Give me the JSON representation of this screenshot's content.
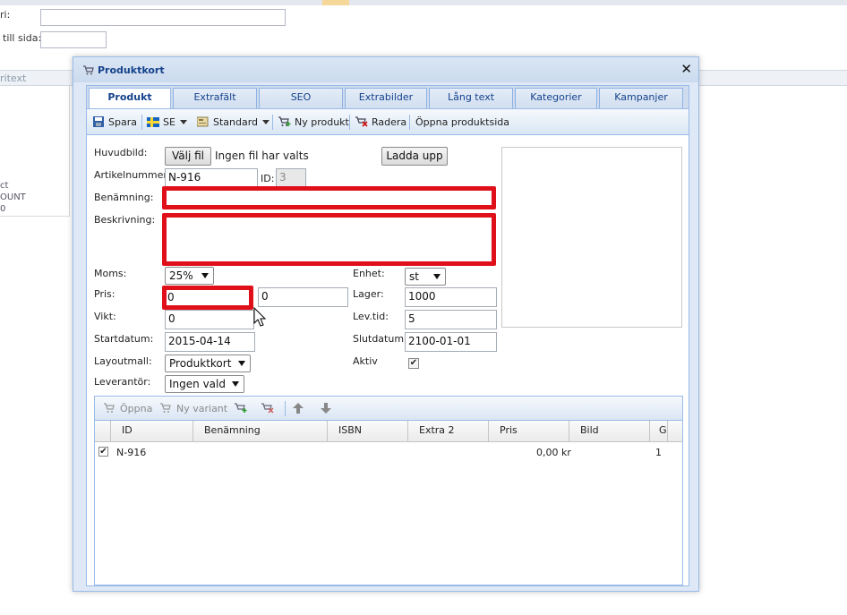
{
  "background": {
    "labels": {
      "field1": "ri:",
      "field2": "till sida:",
      "header": "ritext",
      "left_line1": "ct",
      "left_line2": "OUNT",
      "left_line3": "0"
    }
  },
  "window": {
    "title": "Produktkort",
    "close_symbol": "✕"
  },
  "tabs": [
    "Produkt",
    "Extrafält",
    "SEO",
    "Extrabilder",
    "Lång text",
    "Kategorier",
    "Kampanjer"
  ],
  "active_tab": "Produkt",
  "toolbar": {
    "save": "Spara",
    "language": "SE",
    "template": "Standard",
    "new_product": "Ny produkt",
    "delete": "Radera",
    "open_page": "Öppna produktsida"
  },
  "form": {
    "main_image_label": "Huvudbild:",
    "choose_file": "Välj fil",
    "no_file": "Ingen fil har valts",
    "upload": "Ladda upp",
    "article_label": "Artikelnummer:",
    "article_value": "N-916",
    "id_label": "ID:",
    "id_value": "3",
    "name_label": "Benämning:",
    "name_value": "",
    "description_label": "Beskrivning:",
    "description_value": "",
    "vat_label": "Moms:",
    "vat_value": "25%",
    "price_label": "Pris:",
    "price_value": "0",
    "price_value2": "0",
    "weight_label": "Vikt:",
    "weight_value": "0",
    "start_label": "Startdatum:",
    "start_value": "2015-04-14",
    "layout_label": "Layoutmall:",
    "layout_value": "Produktkort",
    "supplier_label": "Leverantör:",
    "supplier_value": "Ingen vald",
    "unit_label": "Enhet:",
    "unit_value": "st",
    "stock_label": "Lager:",
    "stock_value": "1000",
    "delivery_label": "Lev.tid:",
    "delivery_value": "5",
    "end_label": "Slutdatum:",
    "end_value": "2100-01-01",
    "active_label": "Aktiv",
    "active_checked": true
  },
  "variants": {
    "toolbar": {
      "open": "Öppna",
      "new_variant": "Ny variant"
    },
    "columns": [
      "ID",
      "Benämning",
      "ISBN",
      "Extra 2",
      "Pris",
      "Bild",
      "G"
    ],
    "rows": [
      {
        "checked": true,
        "id": "N-916",
        "name": "",
        "isbn": "",
        "extra2": "",
        "price": "0,00 kr",
        "image": "",
        "g": "1"
      }
    ]
  },
  "colors": {
    "highlight": "#e0101a",
    "title_text": "#15428b",
    "panel_border": "#99bbe8"
  }
}
